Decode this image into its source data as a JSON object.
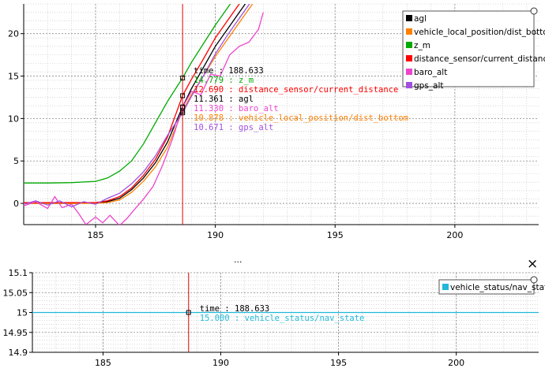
{
  "chart_data": [
    {
      "type": "line",
      "xlim": [
        182,
        203.5
      ],
      "ylim": [
        -2.5,
        23.5
      ],
      "x_ticks": [
        185,
        190,
        195,
        200
      ],
      "y_ticks": [
        0,
        5,
        10,
        15,
        20
      ],
      "grid": true,
      "legend_position": "top-right",
      "cursor_x": 188.633,
      "tooltip_time": "time : 188.633",
      "series": [
        {
          "name": "agl",
          "color": "#000000",
          "x": [
            182,
            183,
            184,
            185,
            185.5,
            186,
            186.5,
            187,
            187.5,
            188,
            188.633,
            189,
            189.5,
            190,
            190.5,
            191,
            191.5,
            192,
            192.5,
            193
          ],
          "y": [
            0,
            0,
            0,
            0.05,
            0.2,
            0.6,
            1.6,
            3.0,
            4.8,
            7.2,
            11.361,
            13.5,
            16.0,
            18.5,
            20.5,
            22.5,
            24.5,
            26.5,
            28.5,
            30.5
          ]
        },
        {
          "name": "vehicle_local_position/dist_bottom",
          "color": "#ff8000",
          "x": [
            182,
            183,
            184,
            185,
            185.5,
            186,
            186.5,
            187,
            187.5,
            188,
            188.633,
            189,
            189.5,
            190,
            190.5,
            191,
            191.5,
            192,
            192.5,
            193
          ],
          "y": [
            0,
            0,
            0,
            0,
            0.1,
            0.4,
            1.3,
            2.6,
            4.3,
            6.6,
            10.878,
            12.8,
            15.0,
            17.3,
            19.3,
            21.3,
            23.3,
            25.3,
            27.3,
            29.3
          ]
        },
        {
          "name": "z_m",
          "color": "#00aa00",
          "x": [
            182,
            183,
            184,
            185,
            185.5,
            186,
            186.5,
            187,
            187.5,
            188,
            188.633,
            189,
            189.5,
            190,
            190.5,
            191,
            191.5,
            192
          ],
          "y": [
            2.4,
            2.4,
            2.45,
            2.6,
            3.0,
            3.8,
            5.0,
            7.0,
            9.5,
            12.0,
            14.779,
            16.6,
            18.8,
            21.0,
            23.0,
            25.0,
            27.0,
            29.0
          ]
        },
        {
          "name": "distance_sensor/current_distance",
          "color": "#ff0000",
          "x": [
            182,
            183,
            184,
            185,
            185.5,
            186,
            186.5,
            187,
            187.5,
            188,
            188.633,
            189,
            189.5,
            190,
            190.5,
            191,
            191.5,
            192
          ],
          "y": [
            0.1,
            0.1,
            0.1,
            0.1,
            0.3,
            0.8,
            1.8,
            3.3,
            5.2,
            7.8,
            12.69,
            14.6,
            17.0,
            19.5,
            21.5,
            23.5,
            25.5,
            27.5
          ]
        },
        {
          "name": "baro_alt",
          "color": "#ee44cc",
          "x": [
            182,
            182.5,
            183,
            183.3,
            183.6,
            184,
            184.3,
            184.6,
            185,
            185.3,
            185.6,
            186,
            186.3,
            186.6,
            187,
            187.4,
            187.8,
            188.2,
            188.633,
            189,
            189.4,
            189.8,
            190.2,
            190.6,
            191,
            191.4,
            191.8,
            192
          ],
          "y": [
            -0.3,
            0.2,
            -0.6,
            0.8,
            -0.5,
            -0.1,
            -1.2,
            -2.5,
            -1.6,
            -2.3,
            -1.4,
            -2.6,
            -1.8,
            -0.8,
            0.5,
            2.0,
            4.5,
            7.5,
            11.33,
            13.2,
            12.8,
            15.2,
            15.0,
            17.5,
            18.5,
            19.0,
            20.5,
            22.5
          ]
        },
        {
          "name": "gps_alt",
          "color": "#a050e0",
          "x": [
            182,
            182.5,
            183,
            183.5,
            184,
            184.5,
            185,
            185.5,
            186,
            186.5,
            187,
            187.5,
            188,
            188.633,
            189,
            189.5,
            190,
            190.5,
            191,
            191.5,
            192
          ],
          "y": [
            -0.1,
            0.3,
            -0.2,
            0.3,
            -0.4,
            0.2,
            -0.1,
            0.6,
            1.2,
            2.3,
            3.7,
            5.6,
            8.0,
            10.671,
            12.6,
            15.0,
            17.6,
            19.8,
            21.8,
            23.8,
            25.8
          ]
        }
      ],
      "tooltip_values": [
        "14.779",
        "12.690",
        "11.361",
        "11.330",
        "10.878",
        "10.671"
      ],
      "tooltip_order": [
        2,
        3,
        0,
        4,
        1,
        5
      ]
    },
    {
      "type": "line",
      "xlim": [
        182,
        203.5
      ],
      "ylim": [
        14.9,
        15.1
      ],
      "x_ticks": [
        185,
        190,
        195,
        200
      ],
      "y_ticks": [
        "14.9",
        "14.95",
        "15",
        "15.05",
        "15.1"
      ],
      "grid": true,
      "legend_position": "top-right",
      "cursor_x": 188.633,
      "tooltip_time": "time : 188.633",
      "series": [
        {
          "name": "vehicle_status/nav_state",
          "color": "#20b8d8",
          "x": [
            182,
            203.5
          ],
          "y": [
            15,
            15
          ]
        }
      ],
      "tooltip_values": [
        "15.000"
      ]
    }
  ],
  "controls": {
    "close_glyph": "×",
    "splitter_glyph": "..."
  }
}
